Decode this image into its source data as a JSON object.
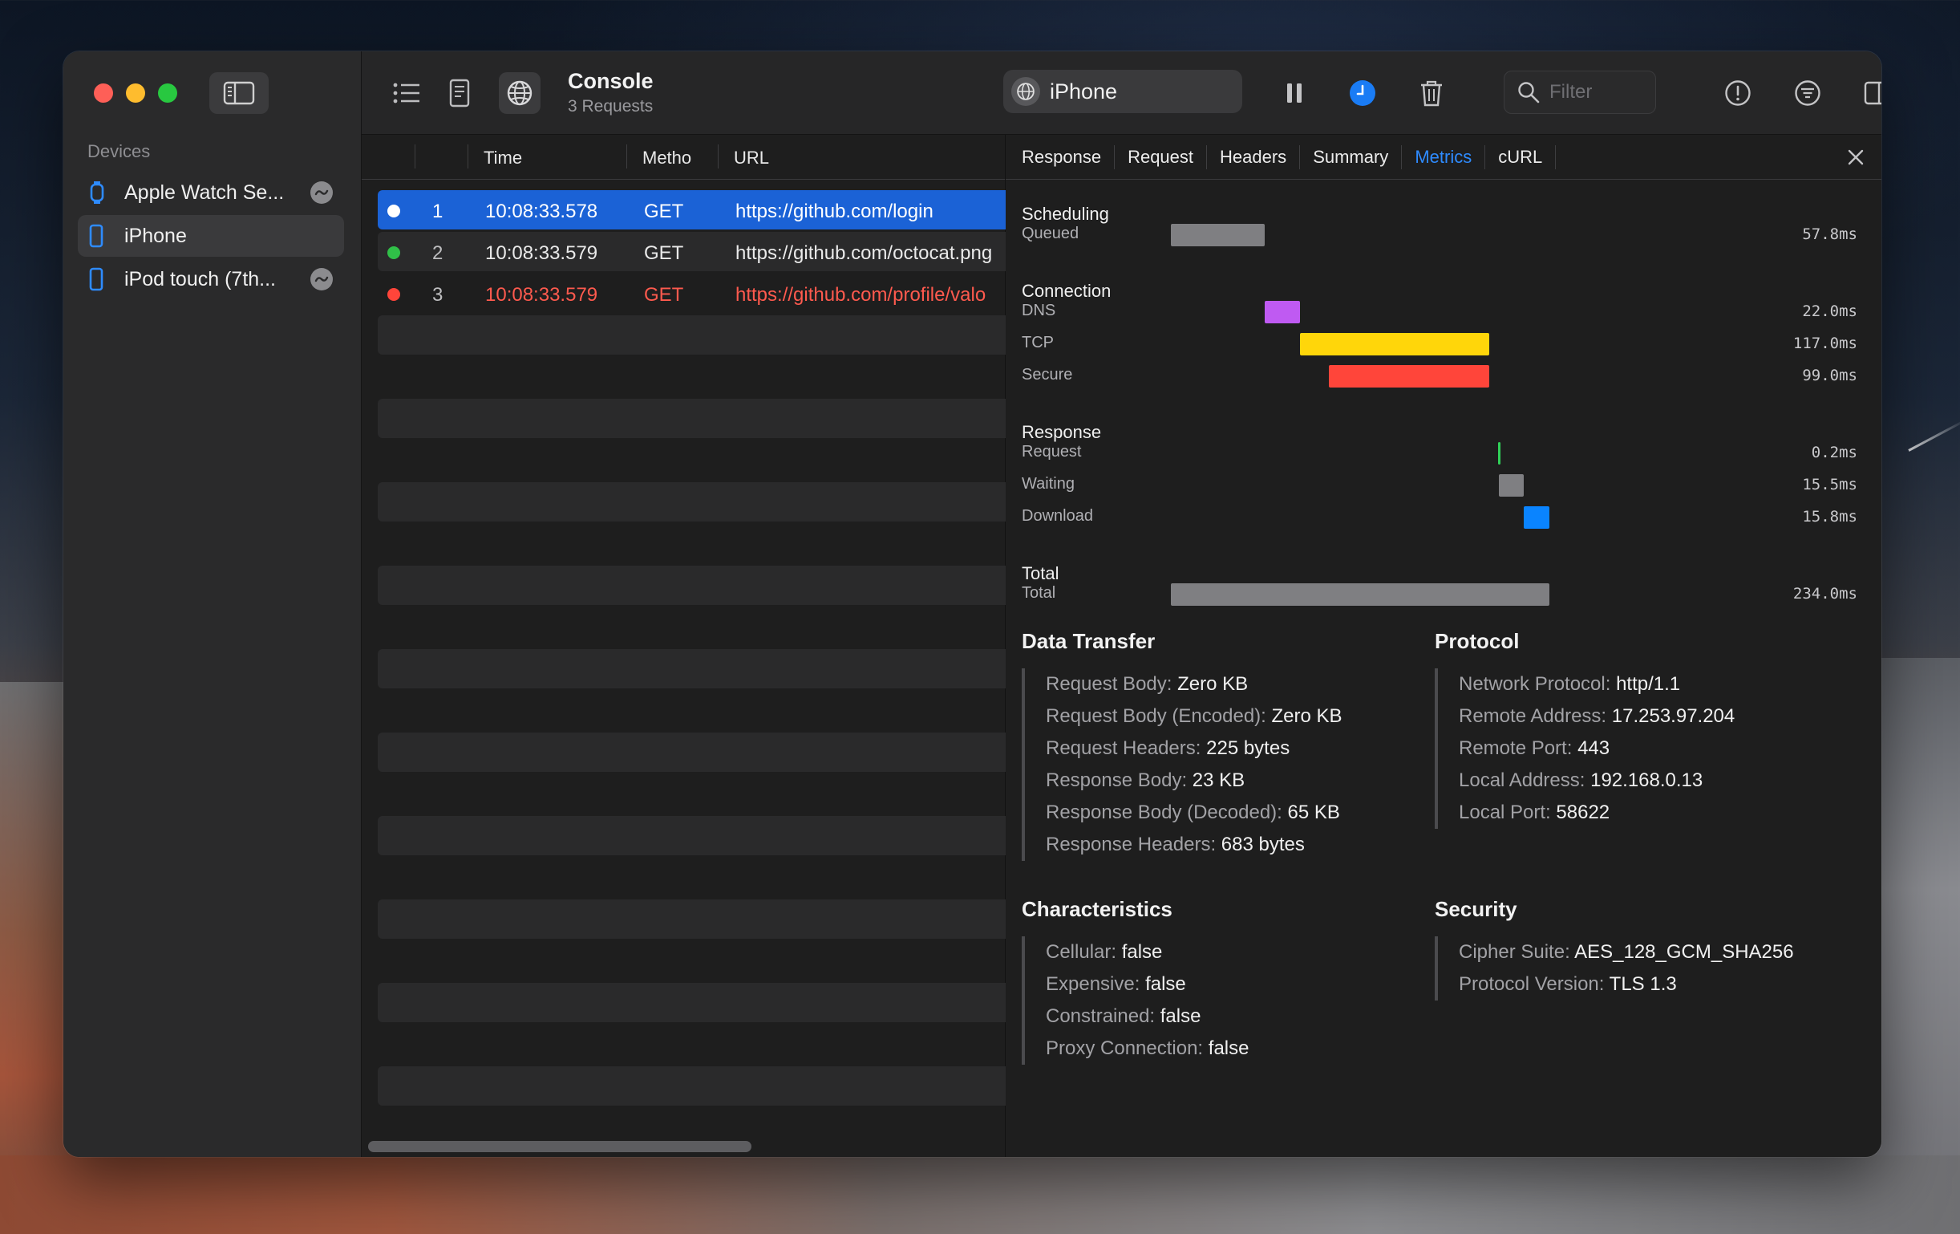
{
  "sidebar": {
    "section_title": "Devices",
    "devices": [
      {
        "label": "Apple Watch Se...",
        "icon": "watch-icon",
        "badge": true
      },
      {
        "label": "iPhone",
        "icon": "iphone-icon",
        "selected": true
      },
      {
        "label": "iPod touch (7th...",
        "icon": "ipod-icon",
        "badge": true
      }
    ]
  },
  "toolbar": {
    "title": "Console",
    "subtitle": "3 Requests",
    "device_picker": "iPhone",
    "filter_placeholder": "Filter"
  },
  "table": {
    "headers": {
      "time": "Time",
      "method": "Metho",
      "url": "URL"
    },
    "rows": [
      {
        "num": "1",
        "time": "10:08:33.578",
        "method": "GET",
        "url": "https://github.com/login",
        "status_color": "#ffffff",
        "selected": true
      },
      {
        "num": "2",
        "time": "10:08:33.579",
        "method": "GET",
        "url": "https://github.com/octocat.png",
        "status_color": "#30c048"
      },
      {
        "num": "3",
        "time": "10:08:33.579",
        "method": "GET",
        "url": "https://github.com/profile/valo",
        "status_color": "#ff453a",
        "error": true
      }
    ]
  },
  "detail": {
    "tabs": [
      "Response",
      "Request",
      "Headers",
      "Summary",
      "Metrics",
      "cURL"
    ],
    "active_tab": "Metrics",
    "metrics": {
      "groups": [
        {
          "title": "Scheduling",
          "items": [
            {
              "label": "Queued",
              "value": "57.8ms",
              "start_ms": 0,
              "duration_ms": 57.8,
              "color": "#7f7f82"
            }
          ]
        },
        {
          "title": "Connection",
          "items": [
            {
              "label": "DNS",
              "value": "22.0ms",
              "start_ms": 57.8,
              "duration_ms": 22.0,
              "color": "#bf5af2"
            },
            {
              "label": "TCP",
              "value": "117.0ms",
              "start_ms": 79.8,
              "duration_ms": 117.0,
              "color": "#ffd60a"
            },
            {
              "label": "Secure",
              "value": "99.0ms",
              "start_ms": 97.8,
              "duration_ms": 99.0,
              "color": "#ff453a"
            }
          ]
        },
        {
          "title": "Response",
          "items": [
            {
              "label": "Request",
              "value": "0.2ms",
              "start_ms": 202.5,
              "duration_ms": 0.2,
              "color": "#30d158"
            },
            {
              "label": "Waiting",
              "value": "15.5ms",
              "start_ms": 202.7,
              "duration_ms": 15.5,
              "color": "#7f7f82"
            },
            {
              "label": "Download",
              "value": "15.8ms",
              "start_ms": 218.2,
              "duration_ms": 15.8,
              "color": "#0a84ff"
            }
          ]
        },
        {
          "title": "Total",
          "items": [
            {
              "label": "Total",
              "value": "234.0ms",
              "start_ms": 0,
              "duration_ms": 234.0,
              "color": "#7f7f82"
            }
          ]
        }
      ],
      "total_ms": 234.0
    },
    "data_transfer": {
      "title": "Data Transfer",
      "items": [
        {
          "k": "Request Body:",
          "v": "Zero KB"
        },
        {
          "k": "Request Body (Encoded):",
          "v": "Zero KB"
        },
        {
          "k": "Request Headers:",
          "v": "225 bytes"
        },
        {
          "k": "Response Body:",
          "v": "23 KB"
        },
        {
          "k": "Response Body (Decoded):",
          "v": "65 KB"
        },
        {
          "k": "Response Headers:",
          "v": "683 bytes"
        }
      ]
    },
    "protocol": {
      "title": "Protocol",
      "items": [
        {
          "k": "Network Protocol:",
          "v": "http/1.1"
        },
        {
          "k": "Remote Address:",
          "v": "17.253.97.204"
        },
        {
          "k": "Remote Port:",
          "v": "443"
        },
        {
          "k": "Local Address:",
          "v": "192.168.0.13"
        },
        {
          "k": "Local Port:",
          "v": "58622"
        }
      ]
    },
    "characteristics": {
      "title": "Characteristics",
      "items": [
        {
          "k": "Cellular:",
          "v": "false"
        },
        {
          "k": "Expensive:",
          "v": "false"
        },
        {
          "k": "Constrained:",
          "v": "false"
        },
        {
          "k": "Proxy Connection:",
          "v": "false"
        }
      ]
    },
    "security": {
      "title": "Security",
      "items": [
        {
          "k": "Cipher Suite:",
          "v": "AES_128_GCM_SHA256"
        },
        {
          "k": "Protocol Version:",
          "v": "TLS 1.3"
        }
      ]
    }
  }
}
